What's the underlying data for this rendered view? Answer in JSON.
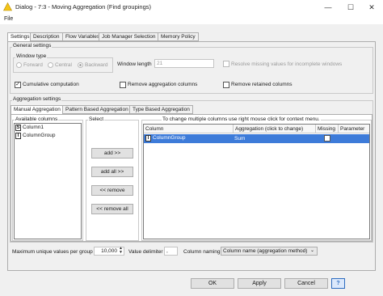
{
  "window": {
    "title": "Dialog - 7:3 - Moving Aggregation (Find groupings)",
    "minimize": "—",
    "maximize": "☐",
    "close": "✕"
  },
  "menu": {
    "file": "File"
  },
  "tabs": [
    "Settings",
    "Description",
    "Flow Variables",
    "Job Manager Selection",
    "Memory Policy"
  ],
  "general": {
    "label": "General settings",
    "window_type_label": "Window type",
    "window_types": [
      "Forward",
      "Central",
      "Backward"
    ],
    "window_type_selected": "Backward",
    "window_length_label": "Window length",
    "window_length_value": "21",
    "resolve_missing_label": "Resolve missing values for incomplete windows",
    "cumulative_label": "Cumulative computation",
    "cumulative_checked": true,
    "remove_agg_label": "Remove aggregation columns",
    "remove_retained_label": "Remove retained columns"
  },
  "aggregation": {
    "label": "Aggregation settings",
    "subtabs": [
      "Manual Aggregation",
      "Pattern Based Aggregation",
      "Type Based Aggregation"
    ],
    "available_label": "Available columns",
    "available": [
      {
        "type": "S",
        "name": "Column1"
      },
      {
        "type": "I",
        "name": "ColumnGroup"
      }
    ],
    "select_label": "Select",
    "buttons": {
      "add": "add >>",
      "add_all": "add all >>",
      "remove": "<< remove",
      "remove_all": "<< remove all"
    },
    "hint": "To change multiple columns use right mouse click for context menu.",
    "columns": [
      "Column",
      "Aggregation (click to change)",
      "Missing",
      "Parameter"
    ],
    "rows": [
      {
        "type": "I",
        "column": "ColumnGroup",
        "aggregation": "Sum",
        "missing": false,
        "parameter": ""
      }
    ]
  },
  "bottom_options": {
    "max_unique_label": "Maximum unique values per group",
    "max_unique_value": "10,000",
    "delimiter_label": "Value delimiter",
    "delimiter_value": ",",
    "naming_label": "Column naming",
    "naming_value": "Column name (aggregation method)"
  },
  "footer": {
    "ok": "OK",
    "apply": "Apply",
    "cancel": "Cancel",
    "help": "?"
  },
  "colors": {
    "selection": "#3d7bd9",
    "help": "#2d6cc0"
  }
}
